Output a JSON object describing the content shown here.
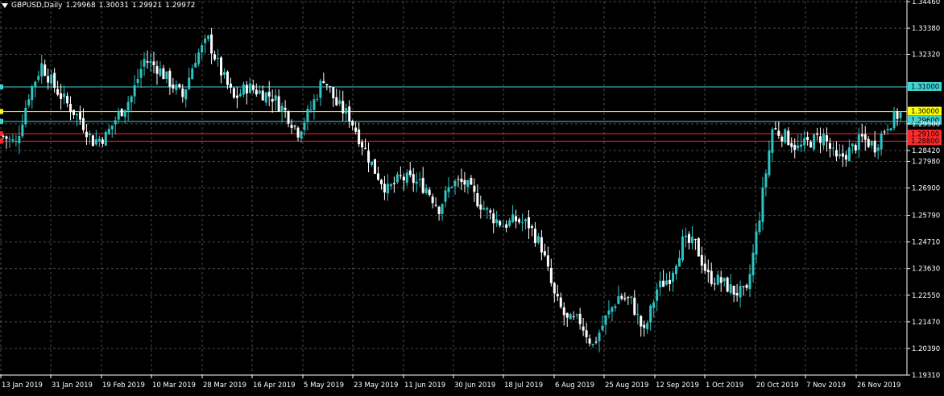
{
  "header": {
    "symbol": "GBPUSD,Daily",
    "open": "1.29968",
    "high": "1.30031",
    "low": "1.29921",
    "close": "1.29972"
  },
  "colors": {
    "background": "#000000",
    "grid": "#4a4a4a",
    "bull": "#2ec4c4",
    "bear": "#ffffff",
    "cyan_line": "#3fd4d4",
    "yellow_line": "#ffff00",
    "red_line": "#ff2a2a"
  },
  "chart_data": {
    "type": "candlestick",
    "grid": true,
    "ylim": [
      1.1931,
      1.3446
    ],
    "y_ticks": [
      "1.34460",
      "1.33380",
      "1.32320",
      "1.29500",
      "1.28420",
      "1.27980",
      "1.26900",
      "1.25790",
      "1.24710",
      "1.23630",
      "1.22550",
      "1.21470",
      "1.20390",
      "1.19310"
    ],
    "x_ticks": [
      "13 Jan 2019",
      "31 Jan 2019",
      "19 Feb 2019",
      "10 Mar 2019",
      "28 Mar 2019",
      "16 Apr 2019",
      "5 May 2019",
      "23 May 2019",
      "11 Jun 2019",
      "30 Jun 2019",
      "18 Jul 2019",
      "6 Aug 2019",
      "25 Aug 2019",
      "12 Sep 2019",
      "1 Oct 2019",
      "20 Oct 2019",
      "7 Nov 2019",
      "26 Nov 2019"
    ],
    "levels": [
      {
        "label": "1.31000",
        "value": 1.31,
        "color": "cyan"
      },
      {
        "label": "1.30000",
        "value": 1.3,
        "color": "yellow"
      },
      {
        "label": "1.29600",
        "value": 1.296,
        "color": "cyan"
      },
      {
        "label": "1.29100",
        "value": 1.291,
        "color": "red"
      },
      {
        "label": "1.28800",
        "value": 1.288,
        "color": "red"
      }
    ],
    "anchors": [
      [
        0,
        1.29
      ],
      [
        4,
        1.287
      ],
      [
        8,
        1.307
      ],
      [
        12,
        1.319
      ],
      [
        16,
        1.31
      ],
      [
        20,
        1.303
      ],
      [
        24,
        1.297
      ],
      [
        28,
        1.288
      ],
      [
        32,
        1.29
      ],
      [
        36,
        1.299
      ],
      [
        40,
        1.306
      ],
      [
        44,
        1.321
      ],
      [
        48,
        1.318
      ],
      [
        52,
        1.312
      ],
      [
        56,
        1.306
      ],
      [
        60,
        1.322
      ],
      [
        64,
        1.329
      ],
      [
        68,
        1.316
      ],
      [
        72,
        1.305
      ],
      [
        76,
        1.31
      ],
      [
        80,
        1.308
      ],
      [
        84,
        1.306
      ],
      [
        88,
        1.3
      ],
      [
        92,
        1.292
      ],
      [
        96,
        1.301
      ],
      [
        100,
        1.314
      ],
      [
        104,
        1.303
      ],
      [
        108,
        1.298
      ],
      [
        112,
        1.287
      ],
      [
        116,
        1.276
      ],
      [
        120,
        1.268
      ],
      [
        124,
        1.273
      ],
      [
        128,
        1.272
      ],
      [
        132,
        1.269
      ],
      [
        136,
        1.261
      ],
      [
        140,
        1.271
      ],
      [
        144,
        1.271
      ],
      [
        148,
        1.264
      ],
      [
        152,
        1.258
      ],
      [
        156,
        1.254
      ],
      [
        160,
        1.256
      ],
      [
        164,
        1.254
      ],
      [
        168,
        1.245
      ],
      [
        172,
        1.225
      ],
      [
        176,
        1.215
      ],
      [
        180,
        1.215
      ],
      [
        184,
        1.205
      ],
      [
        188,
        1.216
      ],
      [
        192,
        1.225
      ],
      [
        196,
        1.223
      ],
      [
        200,
        1.21
      ],
      [
        204,
        1.228
      ],
      [
        208,
        1.233
      ],
      [
        212,
        1.247
      ],
      [
        216,
        1.246
      ],
      [
        220,
        1.233
      ],
      [
        224,
        1.231
      ],
      [
        228,
        1.227
      ],
      [
        232,
        1.226
      ],
      [
        236,
        1.258
      ],
      [
        240,
        1.293
      ],
      [
        244,
        1.29
      ],
      [
        248,
        1.285
      ],
      [
        252,
        1.288
      ],
      [
        256,
        1.29
      ],
      [
        260,
        1.28
      ],
      [
        264,
        1.284
      ],
      [
        268,
        1.289
      ],
      [
        272,
        1.286
      ],
      [
        276,
        1.295
      ],
      [
        280,
        1.2997
      ]
    ],
    "last_price": 1.29972
  }
}
